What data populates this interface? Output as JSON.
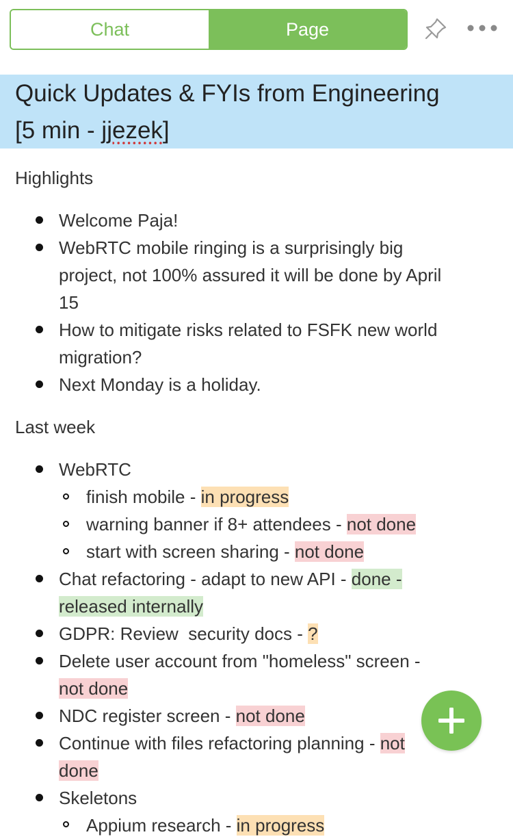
{
  "tabs": {
    "chat_label": "Chat",
    "page_label": "Page",
    "active": "Page"
  },
  "toolbar": {
    "pin_icon": "pin-icon",
    "more_icon": "more-icon"
  },
  "title": {
    "line1": "Quick Updates & FYIs from Engineering",
    "line2_pre": "[5 min - ",
    "line2_name": "jjezek",
    "line2_post": "]"
  },
  "highlights": {
    "label": "Highlights",
    "items": [
      "Welcome Paja!",
      "WebRTC mobile ringing is a surprisingly big",
      "project, not 100% assured it will be done by April",
      "15",
      "How to mitigate risks related to FSFK new world",
      "migration?",
      "Next Monday is a holiday."
    ]
  },
  "last_week": {
    "label": "Last week",
    "webrtc": "WebRTC",
    "sub1_text": "finish mobile - ",
    "sub1_status": "in progress",
    "sub2_text": "warning banner if 8+ attendees - ",
    "sub2_status": "not done",
    "sub3_text": "start with screen sharing - ",
    "sub3_status": "not done",
    "chat_text": "Chat refactoring - adapt to new API - ",
    "chat_status1": "done -",
    "chat_status2": "released internally",
    "gdpr_text": "GDPR: Review  security docs - ",
    "gdpr_status": "?",
    "delete_text": "Delete user account from \"homeless\" screen -",
    "delete_status": "not done",
    "ndc_text": "NDC register screen - ",
    "ndc_status": "not done",
    "files_text": "Continue with files refactoring planning - ",
    "files_status1": "not",
    "files_status2": "done",
    "skeletons": "Skeletons",
    "appium_text": "Appium research - ",
    "appium_status": "in progress"
  },
  "colors": {
    "accent_green": "#7cbf5a",
    "title_bg": "#bfe3f8",
    "in_progress": "#fde0b4",
    "not_done": "#f8d1d3",
    "done": "#d3ebcd"
  },
  "fab": {
    "icon": "plus-icon"
  }
}
